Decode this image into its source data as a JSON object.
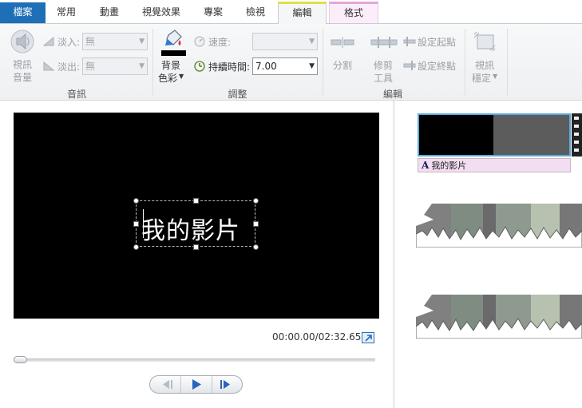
{
  "tabs": [
    {
      "label": "檔案"
    },
    {
      "label": "常用"
    },
    {
      "label": "動畫"
    },
    {
      "label": "視覺效果"
    },
    {
      "label": "專案"
    },
    {
      "label": "檢視"
    },
    {
      "label": "編輯"
    },
    {
      "label": "格式"
    }
  ],
  "ribbon": {
    "audio": {
      "volume_label_line1": "視訊",
      "volume_label_line2": "音量",
      "fade_in_label": "淡入:",
      "fade_in_value": "無",
      "fade_out_label": "淡出:",
      "fade_out_value": "無",
      "group_label": "音訊"
    },
    "adjust": {
      "bg_color_line1": "背景",
      "bg_color_line2": "色彩",
      "speed_label": "速度:",
      "speed_value": "",
      "duration_label": "持續時間:",
      "duration_value": "7.00",
      "group_label": "調整"
    },
    "edit": {
      "split_label": "分割",
      "trim_line1": "修剪",
      "trim_line2": "工具",
      "set_start_label": "設定起點",
      "set_end_label": "設定終點",
      "group_label": "編輯"
    },
    "stabilize": {
      "line1": "視訊",
      "line2": "穩定"
    }
  },
  "preview": {
    "caption_text": "我的影片",
    "time_display": "00:00.00/02:32.65"
  },
  "storyboard": {
    "title_clip_text": "我的影片"
  },
  "colors": {
    "file_tab": "#1d6fb8",
    "edit_tab_accent": "#e0e04a",
    "format_tab_bg": "#fbeefa",
    "selected_clip_border": "#5aa9dc",
    "title_clip_bg": "#f2def0",
    "transport_icon": "#2a64b8"
  },
  "icons": [
    "volume-speaker-icon",
    "fade-in-icon",
    "fade-out-icon",
    "paint-bucket-icon",
    "speed-icon",
    "duration-clock-icon",
    "split-icon",
    "trim-icon",
    "set-start-icon",
    "set-end-icon",
    "stabilize-icon",
    "fullscreen-icon",
    "prev-frame-icon",
    "play-icon",
    "next-frame-icon"
  ]
}
